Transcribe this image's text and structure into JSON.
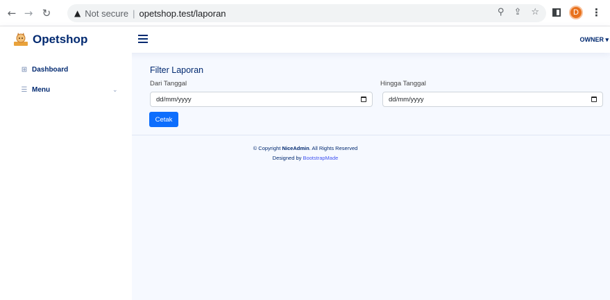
{
  "browser": {
    "not_secure": "Not secure",
    "url": "opetshop.test/laporan",
    "profile_initial": "D"
  },
  "header": {
    "logo_text": "Opetshop",
    "user_label": "OWNER"
  },
  "sidebar": {
    "items": [
      {
        "label": "Dashboard",
        "icon": "grid-icon"
      },
      {
        "label": "Menu",
        "icon": "list-icon"
      }
    ]
  },
  "main": {
    "filter_title": "Filter Laporan",
    "from_label": "Dari Tanggal",
    "to_label": "Hingga Tanggal",
    "from_value": "dd/mm/yyyy",
    "to_value": "dd/mm/yyyy",
    "cetak_label": "Cetak"
  },
  "footer": {
    "copyright_prefix": "© Copyright ",
    "brand": "NiceAdmin",
    "copyright_suffix": ". All Rights Reserved",
    "designed_prefix": "Designed by ",
    "designer": "BootstrapMade"
  },
  "colors": {
    "brand_navy": "#012970",
    "primary_button": "#0d6efd",
    "link": "#4154f1",
    "page_bg": "#f6f9ff"
  }
}
